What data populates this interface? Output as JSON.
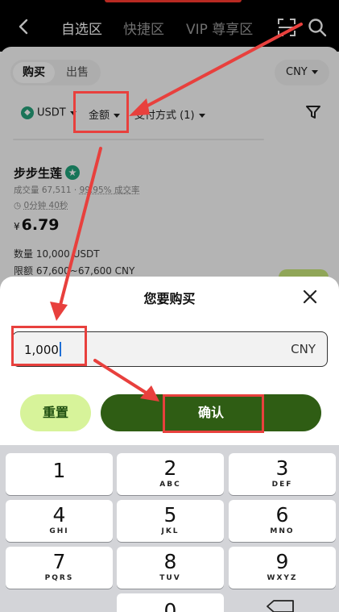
{
  "topbar": {
    "tabs": [
      "自选区",
      "快捷区",
      "VIP 尊享区"
    ],
    "active_tab": 0,
    "icons": [
      "back-icon",
      "scan-icon",
      "search-icon"
    ]
  },
  "page": {
    "segment": {
      "buy": "购买",
      "sell": "出售"
    },
    "currency": "CNY",
    "filters": {
      "coin": "USDT",
      "amount": "金额",
      "payment": "支付方式 (1)"
    },
    "merchant": {
      "name": "步步生莲",
      "stats_volume": "成交量 67,511",
      "stats_rate": "99.95% 成交率",
      "time": "0分钟 40秒",
      "currency_symbol": "¥",
      "price": "6.79",
      "quantity": "数量 10,000 USDT",
      "limit": "限额 67,600~67,600 CNY"
    }
  },
  "sheet": {
    "title": "您要购买",
    "amount_value": "1,000",
    "amount_currency": "CNY",
    "reset_label": "重置",
    "confirm_label": "确认"
  },
  "keypad": {
    "keys": [
      {
        "num": "1",
        "letters": ""
      },
      {
        "num": "2",
        "letters": "ABC"
      },
      {
        "num": "3",
        "letters": "DEF"
      },
      {
        "num": "4",
        "letters": "GHI"
      },
      {
        "num": "5",
        "letters": "JKL"
      },
      {
        "num": "6",
        "letters": "MNO"
      },
      {
        "num": "7",
        "letters": "PQRS"
      },
      {
        "num": "8",
        "letters": "TUV"
      },
      {
        "num": "9",
        "letters": "WXYZ"
      },
      {
        "num": "0",
        "letters": ""
      }
    ]
  },
  "colors": {
    "accent_dark_green": "#2f5d14",
    "accent_light_green": "#d7f39a",
    "annotation_red": "#e8403d"
  }
}
